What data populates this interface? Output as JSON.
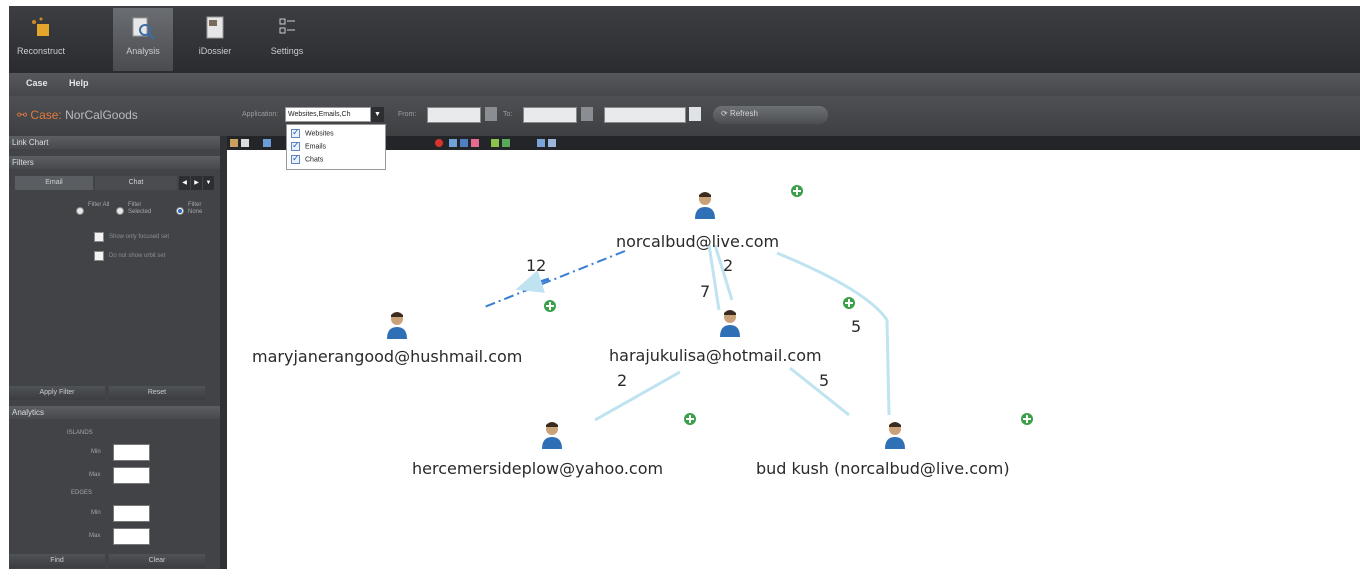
{
  "ribbon": {
    "buttons": [
      {
        "label": "Reconstruct",
        "icon": "reconstruct-icon"
      },
      {
        "label": "Analysis",
        "icon": "analysis-icon"
      },
      {
        "label": "iDossier",
        "icon": "dossier-icon"
      },
      {
        "label": "Settings",
        "icon": "settings-icon"
      }
    ],
    "active": "Analysis"
  },
  "menu": {
    "items": [
      "Case",
      "Help"
    ]
  },
  "toolbar": {
    "case_prefix": "Case:",
    "case_name": "NorCalGoods",
    "application_label": "Application:",
    "application_value": "Websites,Emails,Ch",
    "from_label": "From:",
    "to_label": "To:",
    "refresh_label": "Refresh"
  },
  "application_dropdown": {
    "options": [
      {
        "label": "Websites",
        "checked": true
      },
      {
        "label": "Emails",
        "checked": true
      },
      {
        "label": "Chats",
        "checked": true
      }
    ]
  },
  "left_panel": {
    "title": "Link Chart",
    "filters_header": "Filters",
    "tabs": [
      "Email",
      "Chat"
    ],
    "radios": [
      {
        "label": "Filter All"
      },
      {
        "label": "Filter Selected"
      },
      {
        "label": "Filter None",
        "selected": true
      }
    ],
    "checkboxes": [
      "Show only focused set",
      "Do not show orbit set"
    ],
    "apply_filter": "Apply Filter",
    "reset": "Reset",
    "analytics_header": "Analytics",
    "islands_label": "ISLANDS",
    "edges_label": "EDGES",
    "min_label": "Min",
    "max_label": "Max",
    "find": "Find",
    "clear": "Clear"
  },
  "graph": {
    "nodes": [
      {
        "label": "norcalbud@live.com"
      },
      {
        "label": "maryjanerangood@hushmail.com"
      },
      {
        "label": "harajukulisa@hotmail.com"
      },
      {
        "label": "hercemersideplow@yahoo.com"
      },
      {
        "label": "bud kush (norcalbud@live.com)"
      }
    ],
    "edges": [
      {
        "from": "norcalbud@live.com",
        "to": "maryjanerangood@hushmail.com",
        "count": "12"
      },
      {
        "from": "norcalbud@live.com",
        "to": "harajukulisa@hotmail.com",
        "count": "2"
      },
      {
        "from": "harajukulisa@hotmail.com",
        "to": "norcalbud@live.com",
        "count": "7"
      },
      {
        "from": "norcalbud@live.com",
        "to": "bud kush (norcalbud@live.com)",
        "count": "5"
      },
      {
        "from": "harajukulisa@hotmail.com",
        "to": "hercemersideplow@yahoo.com",
        "count": "2"
      },
      {
        "from": "harajukulisa@hotmail.com",
        "to": "bud kush (norcalbud@live.com)",
        "count": "5"
      }
    ]
  },
  "colors": {
    "accent_orange": "#e07a3a",
    "edge_blue": "#a8d8ea",
    "edge_dark_blue": "#3b7fd1",
    "expand_green": "#3aa04a"
  }
}
